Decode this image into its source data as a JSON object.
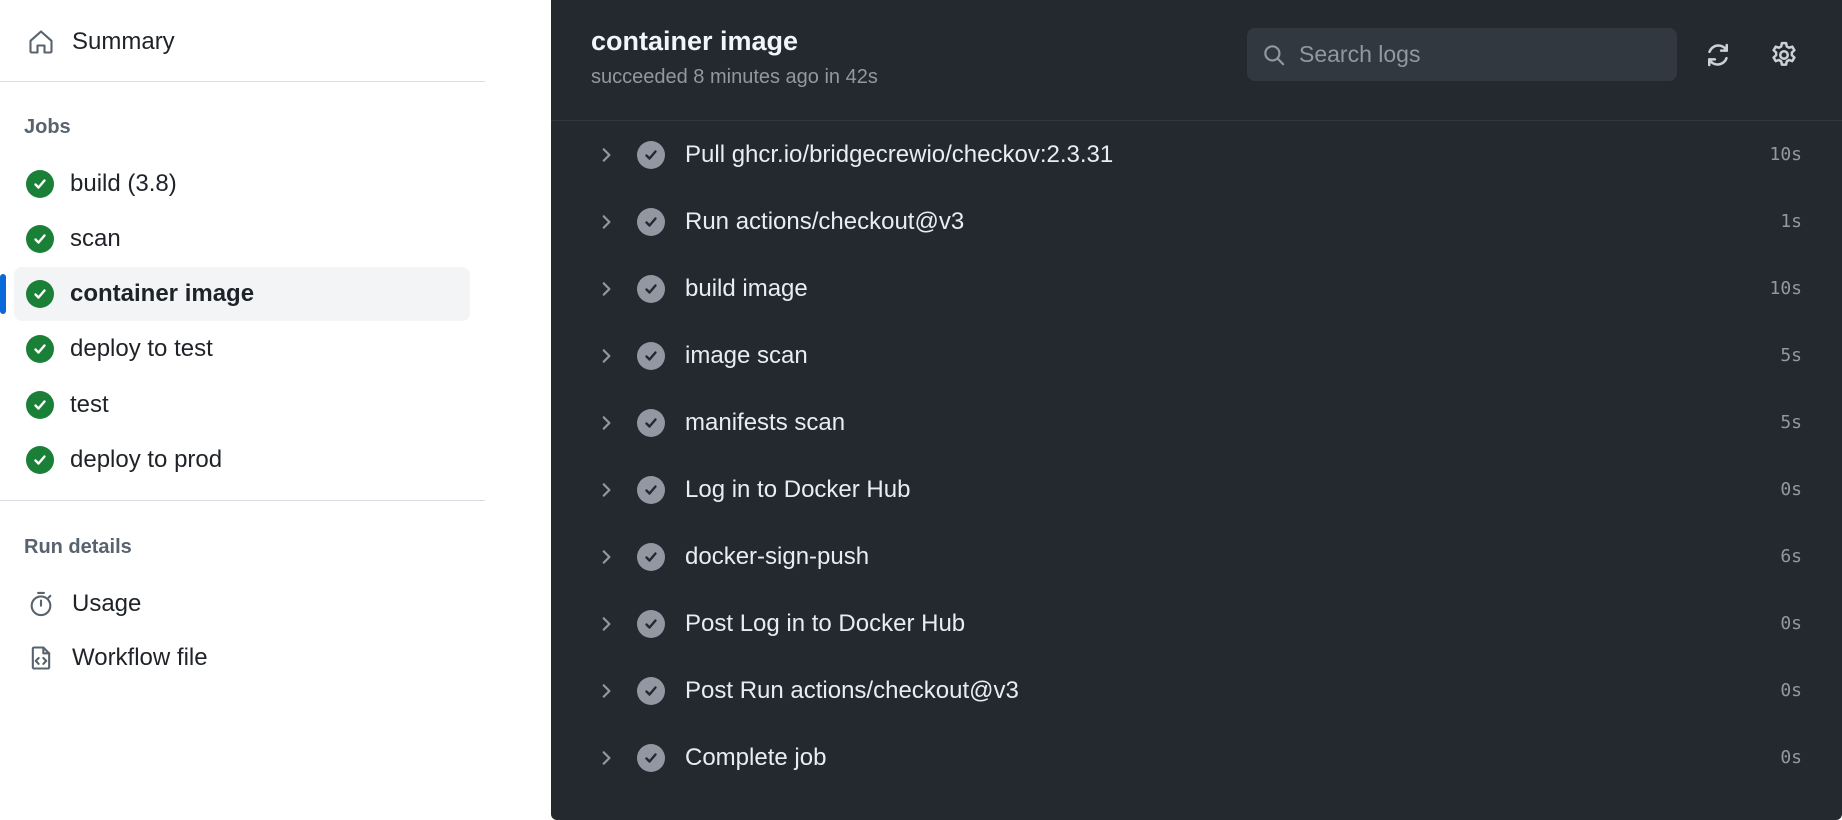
{
  "sidebar": {
    "summary_label": "Summary",
    "jobs_heading": "Jobs",
    "jobs": [
      {
        "label": "build (3.8)",
        "status": "success"
      },
      {
        "label": "scan",
        "status": "success"
      },
      {
        "label": "container image",
        "status": "success",
        "active": true
      },
      {
        "label": "deploy to test",
        "status": "success"
      },
      {
        "label": "test",
        "status": "success"
      },
      {
        "label": "deploy to prod",
        "status": "success"
      }
    ],
    "run_details_heading": "Run details",
    "usage_label": "Usage",
    "workflow_file_label": "Workflow file"
  },
  "panel": {
    "title": "container image",
    "subtitle": "succeeded 8 minutes ago in 42s",
    "search_placeholder": "Search logs",
    "steps": [
      {
        "name": "Pull ghcr.io/bridgecrewio/checkov:2.3.31",
        "duration": "10s"
      },
      {
        "name": "Run actions/checkout@v3",
        "duration": "1s"
      },
      {
        "name": "build image",
        "duration": "10s"
      },
      {
        "name": "image scan",
        "duration": "5s"
      },
      {
        "name": "manifests scan",
        "duration": "5s"
      },
      {
        "name": "Log in to Docker Hub",
        "duration": "0s"
      },
      {
        "name": "docker-sign-push",
        "duration": "6s"
      },
      {
        "name": "Post Log in to Docker Hub",
        "duration": "0s"
      },
      {
        "name": "Post Run actions/checkout@v3",
        "duration": "0s"
      },
      {
        "name": "Complete job",
        "duration": "0s"
      }
    ]
  },
  "colors": {
    "success": "#1a7f37",
    "accent": "#0969da",
    "panel_bg": "#24292f",
    "step_done": "#9198a1"
  },
  "icons": {
    "summary": "home-icon",
    "job_status": "check-circle-icon",
    "usage": "stopwatch-icon",
    "workflow_file": "file-code-icon",
    "search": "search-icon",
    "refresh": "sync-icon",
    "settings": "gear-icon",
    "expand": "chevron-right-icon"
  }
}
